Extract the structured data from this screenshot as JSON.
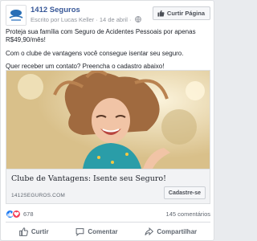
{
  "post": {
    "page_name": "1412 Seguros",
    "author_line": "Escrito por Lucas Keller",
    "date": "14 de abril",
    "meta_separator": "·",
    "like_page_label": "Curtir Página",
    "text_lines": [
      "Proteja sua família com Seguro de Acidentes Pessoais por apenas R$49,90/mês!",
      "Com o clube de vantagens você consegue isentar seu seguro.",
      "Quer receber um contato? Preencha o cadastro abaixo!"
    ]
  },
  "link_preview": {
    "title": "Clube de Vantagens: Isente seu Seguro!",
    "domain": "1412SEGUROS.COM",
    "cta_label": "Cadastre-se"
  },
  "stats": {
    "reaction_count": "678",
    "comments_count": "145 comentários"
  },
  "actions": {
    "like": "Curtir",
    "comment": "Comentar",
    "share": "Compartilhar"
  },
  "colors": {
    "link_blue": "#385898",
    "like_blue": "#1877f2",
    "love_red": "#f33e58",
    "logo_blue": "#2a6fb6"
  },
  "icons": {
    "avatar": "1412-seguros-logo",
    "like_page": "thumbs-up-icon",
    "privacy": "globe-icon",
    "reaction_like": "like-reaction-icon",
    "reaction_love": "love-reaction-icon",
    "like_action": "thumbs-up-icon",
    "comment_action": "comment-icon",
    "share_action": "share-arrow-icon"
  }
}
